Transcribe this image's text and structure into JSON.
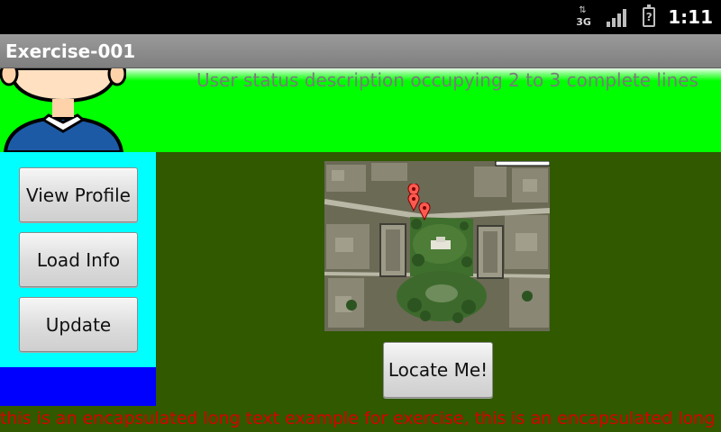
{
  "status_bar": {
    "network_label": "3G",
    "time": "1:11",
    "icons": [
      "data-activity-icon",
      "signal-strength-icon",
      "battery-unknown-icon"
    ]
  },
  "app": {
    "title": "Exercise-001"
  },
  "header": {
    "user_status": "User status description occupying 2 to 3 complete lines",
    "avatar_icon": "user-avatar-icon"
  },
  "sidebar": {
    "buttons": [
      {
        "label": "View Profile"
      },
      {
        "label": "Load Info"
      },
      {
        "label": "Update"
      }
    ]
  },
  "map": {
    "locate_label": "Locate Me!",
    "marker_icon": "map-pin-icon"
  },
  "footer": {
    "long_text": "this is an encapsulated long text example for exercise, this is an encapsulated long text example for exercise"
  },
  "colors": {
    "header_bg": "#00ff00",
    "sidebar_bg": "#00ffff",
    "sidebar_bottom_bg": "#0000ff",
    "main_bg": "#305900",
    "footer_text": "#d80000"
  }
}
